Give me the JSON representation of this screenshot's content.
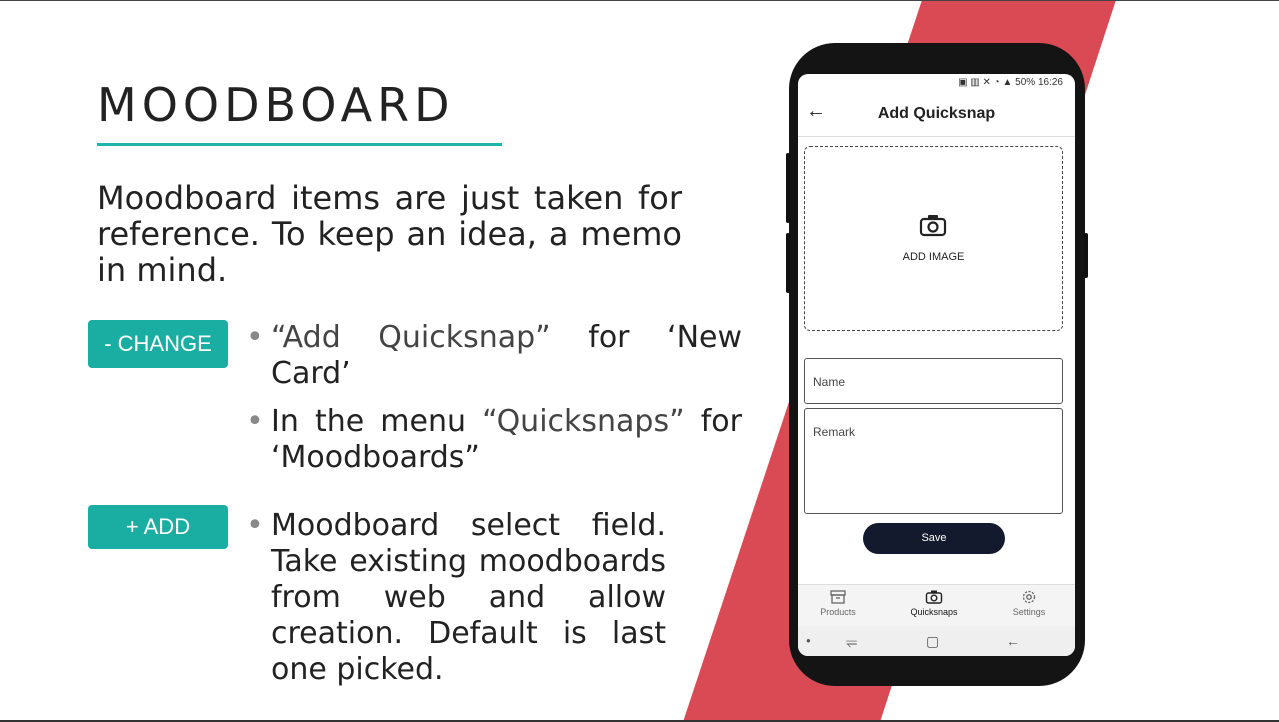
{
  "slide": {
    "title": "MOODBOARD",
    "intro": "Moodboard items are just taken for reference. To keep an idea, a memo in mind.",
    "accent_color": "#1aaea3",
    "stripe_color": "#d94a55"
  },
  "tags": {
    "change": "- CHANGE",
    "add": "+ ADD"
  },
  "change_bullets": {
    "b1_quote": "“Add Quicksnap”",
    "b1_rest": " for ‘New Card’",
    "b2_a": "In the menu ",
    "b2_quote": "“Quicksnaps”",
    "b2_rest": " for ‘Moodboards”"
  },
  "add_bullets": {
    "text": "Moodboard select field. Take existing moodboards from web and allow creation. Default is last one picked."
  },
  "phone": {
    "status": "50% 16:26",
    "app_title": "Add Quicksnap",
    "back_icon": "arrow-left-icon",
    "add_image_label": "ADD IMAGE",
    "name_placeholder": "Name",
    "remark_placeholder": "Remark",
    "save_label": "Save",
    "tabs": [
      {
        "label": "Products",
        "icon": "archive-icon"
      },
      {
        "label": "Quicksnaps",
        "icon": "camera-icon",
        "active": true
      },
      {
        "label": "Settings",
        "icon": "gear-icon"
      }
    ]
  }
}
